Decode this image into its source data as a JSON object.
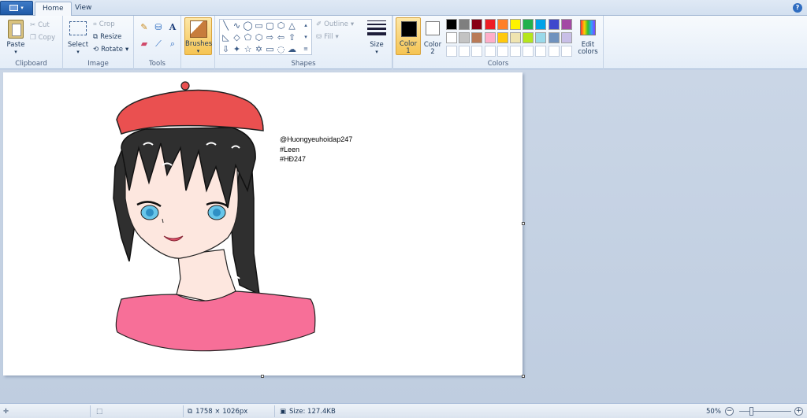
{
  "tabs": [
    {
      "label": "Home",
      "active": true
    },
    {
      "label": "View",
      "active": false
    }
  ],
  "help_glyph": "?",
  "groups": {
    "clipboard": {
      "label": "Clipboard",
      "paste": "Paste",
      "cut": "Cut",
      "copy": "Copy"
    },
    "image": {
      "label": "Image",
      "select": "Select",
      "crop": "Crop",
      "resize": "Resize",
      "rotate": "Rotate"
    },
    "tools": {
      "label": "Tools"
    },
    "brushes": {
      "label": "Brushes"
    },
    "shapes": {
      "label": "Shapes",
      "outline": "Outline",
      "fill": "Fill"
    },
    "size": {
      "label": "Size"
    },
    "colors": {
      "label": "Colors",
      "color1_label": "Color",
      "color1_num": "1",
      "color2_label": "Color",
      "color2_num": "2",
      "edit_label_line1": "Edit",
      "edit_label_line2": "colors",
      "palette_row1": [
        "#000000",
        "#7f7f7f",
        "#880015",
        "#ed1c24",
        "#ff7f27",
        "#fff200",
        "#22b14c",
        "#00a2e8",
        "#3f48cc",
        "#a349a4"
      ],
      "palette_row2": [
        "#ffffff",
        "#c3c3c3",
        "#b97a57",
        "#ffaec9",
        "#ffc90e",
        "#efe4b0",
        "#b5e61d",
        "#99d9ea",
        "#7092be",
        "#c8bfe7"
      ]
    }
  },
  "canvas_text": {
    "line1": "@Huongyeuhoidap247",
    "line2": "#Leen",
    "line3": "#HĐ247"
  },
  "status": {
    "dimensions": "1758 × 1026px",
    "size": "Size: 127.4KB",
    "zoom": "50%"
  }
}
